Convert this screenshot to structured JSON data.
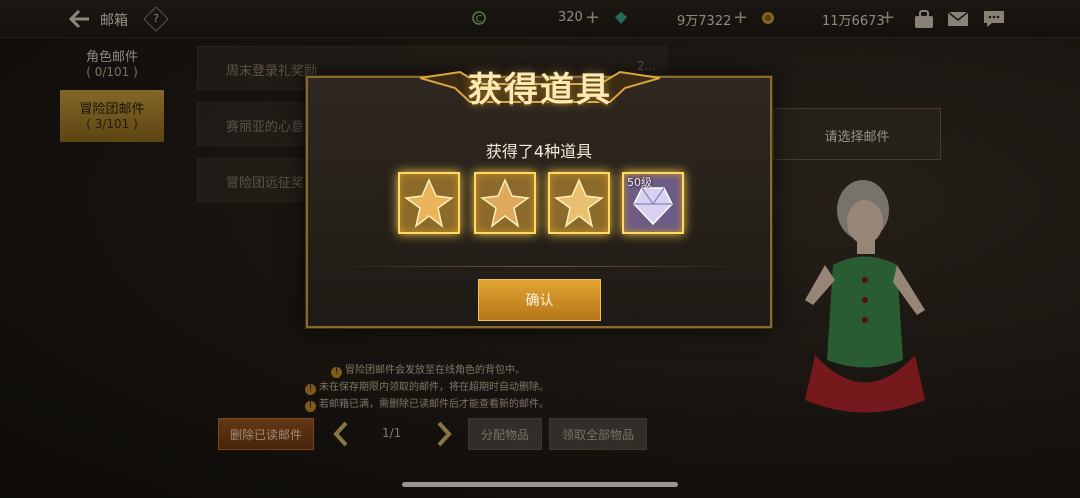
{
  "topbar": {
    "title": "邮箱",
    "help": "?",
    "currency": [
      {
        "name": "coin-c",
        "value": "320",
        "plus": "+"
      },
      {
        "name": "gem",
        "value": "9万7322",
        "plus": "+"
      },
      {
        "name": "gold",
        "value": "11万6673",
        "plus": "+"
      }
    ]
  },
  "sidebar": {
    "items": [
      {
        "label": "角色邮件",
        "count": "( 0/101 )"
      },
      {
        "label": "冒险团邮件",
        "count": "( 3/101 )"
      }
    ]
  },
  "mail_list": [
    {
      "title": "周末登录礼奖励",
      "date": "2..."
    },
    {
      "title": "赛丽亚的心意",
      "date": ""
    },
    {
      "title": "冒险团远征奖",
      "date": ""
    }
  ],
  "hint": {
    "text": "请选择邮件"
  },
  "notes": [
    "冒险团邮件会发放至在线角色的背包中。",
    "未在保存期限内领取的邮件，将在超期时自动删除。",
    "若邮箱已满，需删除已读邮件后才能查看新的邮件。"
  ],
  "note_icon": "!",
  "controls": {
    "delete_read": "删除已读邮件",
    "page": "1/1",
    "distribute": "分配物品",
    "claim_all": "领取全部物品"
  },
  "modal": {
    "title": "获得道具",
    "subtitle": "获得了4种道具",
    "items": [
      {
        "icon": "golden-leaf-icon"
      },
      {
        "icon": "golden-leaf-icon"
      },
      {
        "icon": "golden-leaf-icon"
      },
      {
        "icon": "crystal-gift-icon",
        "badge": "50级"
      }
    ],
    "confirm": "确认"
  },
  "colors": {
    "accent_gold": "#c9a03e",
    "confirm_orange": "#e2a433",
    "delete_orange": "#9a5521"
  }
}
